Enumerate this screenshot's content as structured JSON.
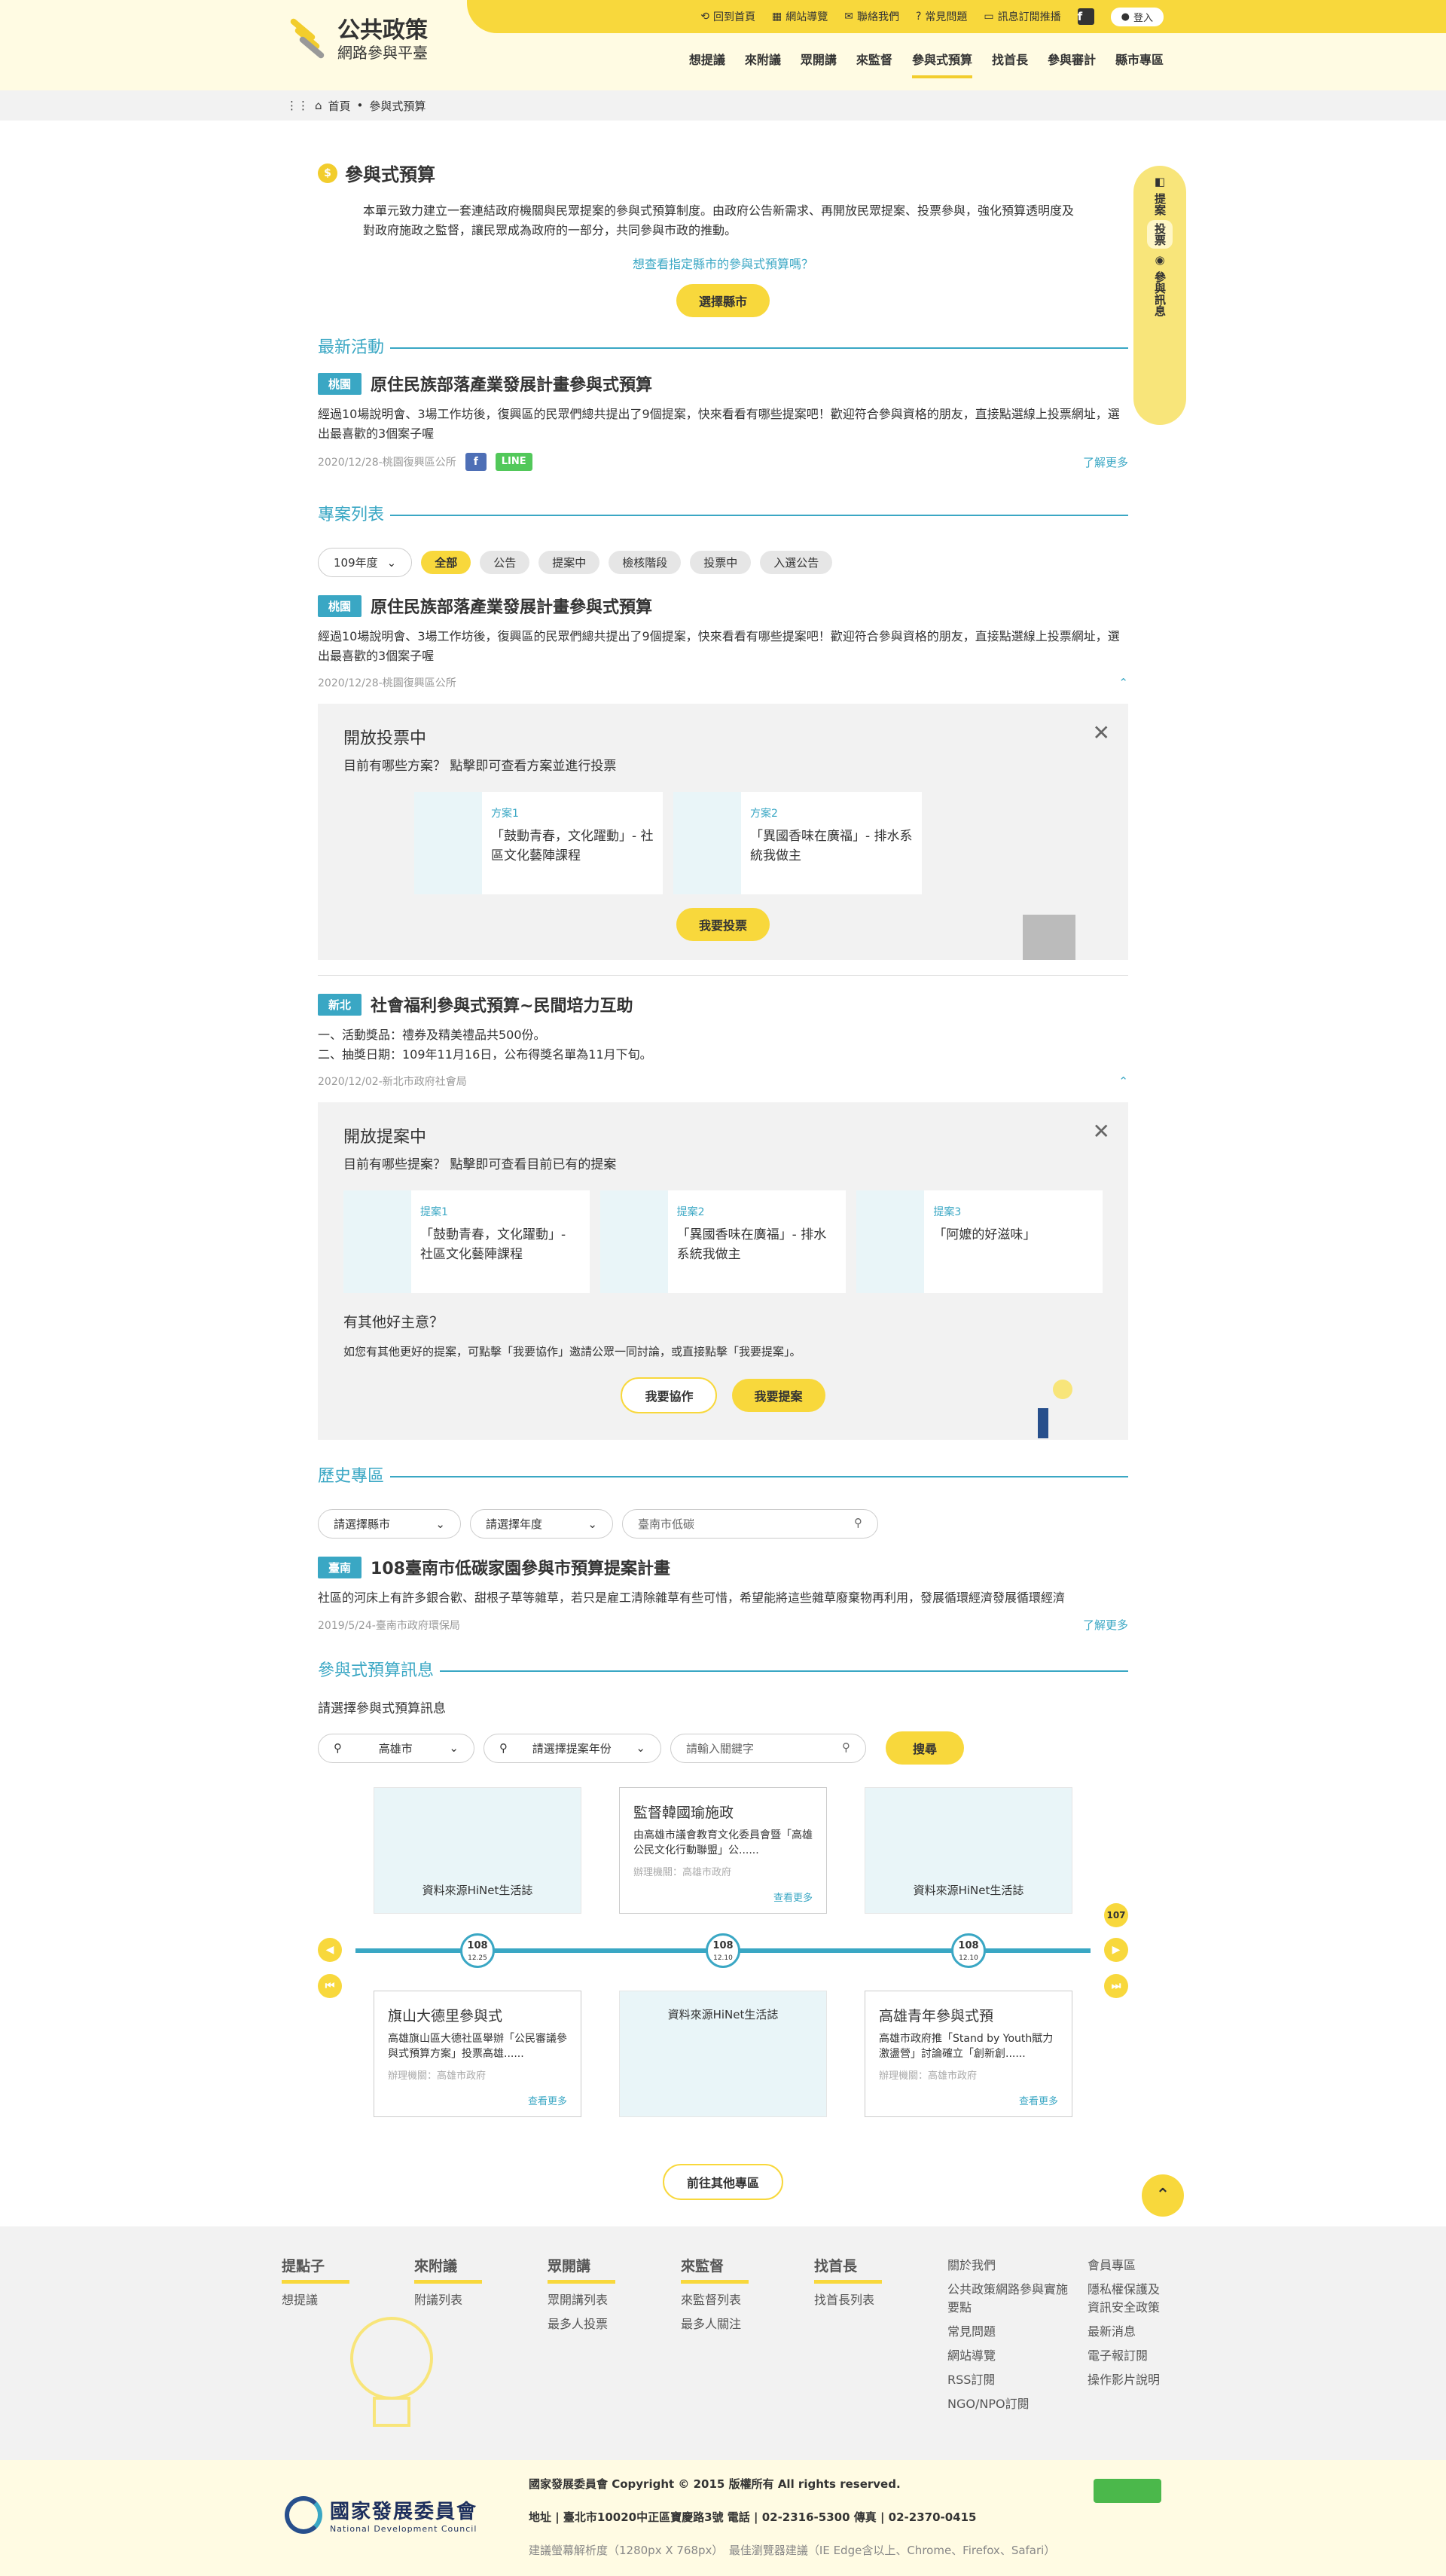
{
  "site": {
    "title": "公共政策",
    "subtitle": "網路參與平臺"
  },
  "topbar": {
    "home": "回到首頁",
    "guide": "網站導覽",
    "contact": "聯絡我們",
    "faq": "常見問題",
    "subscribe": "訊息訂閱推播",
    "fb": "f",
    "login": "登入"
  },
  "nav": [
    "想提議",
    "來附議",
    "眾開講",
    "來監督",
    "參與式預算",
    "找首長",
    "參與審計",
    "縣市專區"
  ],
  "breadcrumb": {
    "home": "首頁",
    "sep": "•",
    "current": "參與式預算"
  },
  "page": {
    "title": "參與式預算",
    "intro": "本單元致力建立一套連結政府機關與民眾提案的參與式預算制度。由政府公告新需求、再開放民眾提案、投票參與，強化預算透明度及對政府施政之監督，讓民眾成為政府的一部分，共同參與市政的推動。",
    "question": "想查看指定縣市的參與式預算嗎？",
    "select_city": "選擇縣市"
  },
  "side": {
    "a": "提案",
    "b": "投票",
    "c": "參與訊息"
  },
  "latest": {
    "section": "最新活動",
    "tag": "桃園",
    "title": "原住民族部落產業發展計畫參與式預算",
    "desc": "經過10場說明會、3場工作坊後，復興區的民眾們總共提出了9個提案，快來看看有哪些提案吧！歡迎符合參與資格的朋友，直接點選線上投票網址，選出最喜歡的3個案子喔",
    "meta": "2020/12/28-桃園復興區公所",
    "fb": "f",
    "line": "LINE",
    "more": "了解更多"
  },
  "projects": {
    "section": "專案列表",
    "year": "109年度",
    "filters": [
      "全部",
      "公告",
      "提案中",
      "檢核階段",
      "投票中",
      "入選公告"
    ],
    "item1": {
      "tag": "桃園",
      "title": "原住民族部落產業發展計畫參與式預算",
      "desc": "經過10場說明會、3場工作坊後，復興區的民眾們總共提出了9個提案，快來看看有哪些提案吧！歡迎符合參與資格的朋友，直接點選線上投票網址，選出最喜歡的3個案子喔",
      "meta": "2020/12/28-桃園復興區公所",
      "panel": {
        "title": "開放投票中",
        "sub": "目前有哪些方案？ 點擊即可查看方案並進行投票",
        "cards": [
          {
            "lbl": "方案1",
            "name": "「鼓動青春，文化躍動」- 社區文化藝陣課程"
          },
          {
            "lbl": "方案2",
            "name": "「異國香味在廣福」- 排水系統我做主"
          }
        ],
        "btn": "我要投票"
      }
    },
    "item2": {
      "tag": "新北",
      "title": "社會福利參與式預算~民間培力互助",
      "desc1": "一、活動獎品：禮券及精美禮品共500份。",
      "desc2": "二、抽獎日期：109年11月16日，公布得獎名單為11月下旬。",
      "meta": "2020/12/02-新北市政府社會局",
      "panel": {
        "title": "開放提案中",
        "sub": "目前有哪些提案？ 點擊即可查看目前已有的提案",
        "cards": [
          {
            "lbl": "提案1",
            "name": "「鼓動青春，文化躍動」- 社區文化藝陣課程"
          },
          {
            "lbl": "提案2",
            "name": "「異國香味在廣福」- 排水系統我做主"
          },
          {
            "lbl": "提案3",
            "name": "「阿嬤的好滋味」"
          }
        ],
        "idea": "有其他好主意？",
        "idea_desc": "如您有其他更好的提案，可點擊「我要協作」邀請公眾一同討論，或直接點擊「我要提案」。",
        "collab": "我要協作",
        "propose": "我要提案"
      }
    }
  },
  "history": {
    "section": "歷史專區",
    "city": "請選擇縣市",
    "year": "請選擇年度",
    "search": "臺南市低碳",
    "tag": "臺南",
    "title": "108臺南市低碳家園參與市預算提案計畫",
    "desc": "社區的河床上有許多銀合歡、甜根子草等雜草，若只是雇工清除雜草有些可惜，希望能將這些雜草廢棄物再利用，發展循環經濟發展循環經濟",
    "meta": "2019/5/24-臺南市政府環保局",
    "more": "了解更多"
  },
  "info": {
    "section": "參與式預算訊息",
    "label": "請選擇參與式預算訊息",
    "city": "高雄市",
    "year": "請選擇提案年份",
    "keyword": "請輸入關鍵字",
    "search": "搜尋",
    "top_cards": [
      {
        "src": "資料來源HiNet生活誌"
      },
      {
        "title": "監督韓國瑜施政",
        "desc": "由高雄市議會教育文化委員會暨「高雄公民文化行動聯盟」公......",
        "org": "辦理機關：高雄市政府",
        "more": "查看更多"
      },
      {
        "src": "資料來源HiNet生活誌"
      }
    ],
    "bottom_cards": [
      {
        "title": "旗山大德里參與式",
        "desc": "高雄旗山區大德社區舉辦「公民審議參與式預算方案」投票高雄......",
        "org": "辦理機關：高雄市政府",
        "more": "查看更多"
      },
      {
        "src": "資料來源HiNet生活誌"
      },
      {
        "title": "高雄青年參與式預",
        "desc": "高雄市政府推「Stand by Youth賦力激盪營」討論確立「創新創......",
        "org": "辦理機關：高雄市政府",
        "more": "查看更多"
      }
    ],
    "nodes": [
      {
        "y": "108",
        "d": "12.25"
      },
      {
        "y": "108",
        "d": "12.10"
      },
      {
        "y": "108",
        "d": "12.10"
      }
    ],
    "year_badge": "107",
    "other": "前往其他專區"
  },
  "footer": {
    "cols": [
      {
        "h": "提點子",
        "items": [
          "想提議"
        ]
      },
      {
        "h": "來附議",
        "items": [
          "附議列表"
        ]
      },
      {
        "h": "眾開講",
        "items": [
          "眾開講列表",
          "最多人投票"
        ]
      },
      {
        "h": "來監督",
        "items": [
          "來監督列表",
          "最多人關注"
        ]
      },
      {
        "h": "找首長",
        "items": [
          "找首長列表"
        ]
      }
    ],
    "links1": [
      "關於我們",
      "公共政策網路參與實施要點",
      "常見問題",
      "網站導覽",
      "RSS訂閱",
      "NGO/NPO訂閱"
    ],
    "links2": [
      "會員專區",
      "隱私權保護及資訊安全政策",
      "最新消息",
      "電子報訂閱",
      "操作影片說明"
    ]
  },
  "bottom": {
    "org": "國家發展委員會",
    "org_en": "National Development Council",
    "copy": "國家發展委員會 Copyright © 2015 版權所有 All rights reserved.",
    "addr": "地址 | 臺北市10020中正區寶慶路3號 電話 | 02-2316-5300 傳真 | 02-2370-0415",
    "browser": "建議螢幕解析度（1280px X 768px）　最佳瀏覽器建議（IE Edge含以上、Chrome、Firefox、Safari）"
  }
}
